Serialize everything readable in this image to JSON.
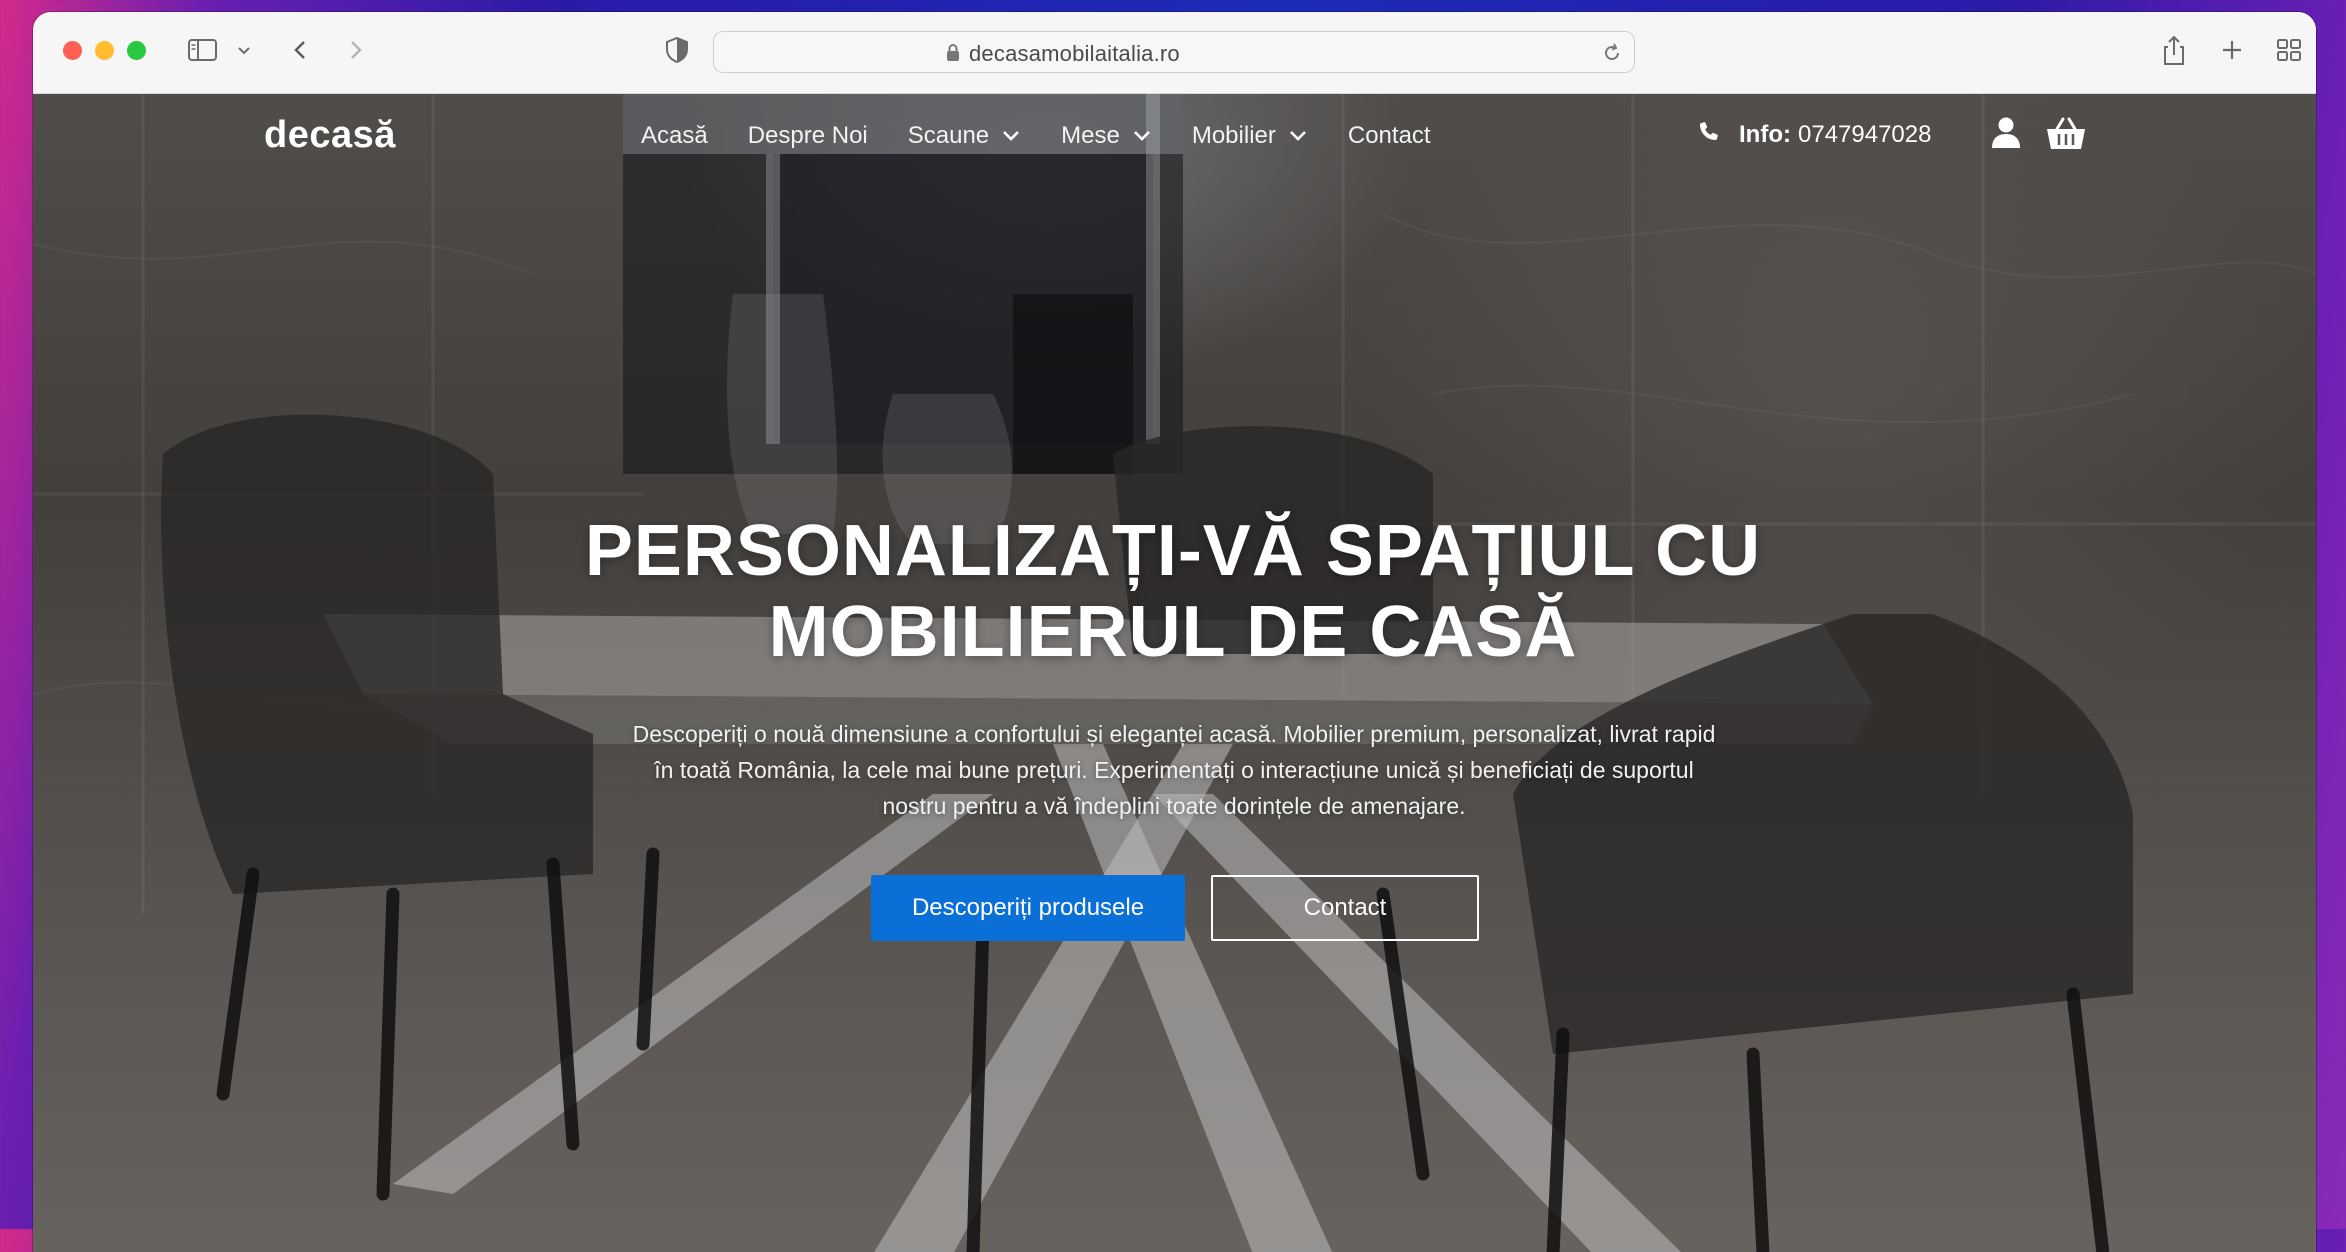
{
  "browser": {
    "url": "decasamobilaitalia.ro"
  },
  "site": {
    "logo": "decasă",
    "nav": [
      {
        "label": "Acasă",
        "dropdown": false
      },
      {
        "label": "Despre Noi",
        "dropdown": false
      },
      {
        "label": "Scaune",
        "dropdown": true
      },
      {
        "label": "Mese",
        "dropdown": true
      },
      {
        "label": "Mobilier",
        "dropdown": true
      },
      {
        "label": "Contact",
        "dropdown": false
      }
    ],
    "info_label": "Info:",
    "info_phone": "0747947028"
  },
  "hero": {
    "title_line1": "PERSONALIZAȚI-VĂ SPAȚIUL CU",
    "title_line2": "MOBILIERUL DE CASĂ",
    "desc_line1": "Descoperiți o nouă dimensiune a confortului și eleganței acasă. Mobilier premium, personalizat, livrat rapid",
    "desc_line2": "în toată România, la cele mai bune prețuri. Experimentați o interacțiune unică și beneficiați de suportul",
    "desc_line3": "nostru pentru a vă îndeplini toate dorințele de amenajare.",
    "cta_primary": "Descoperiți produsele",
    "cta_secondary": "Contact"
  },
  "colors": {
    "accent": "#0b6fd8"
  }
}
